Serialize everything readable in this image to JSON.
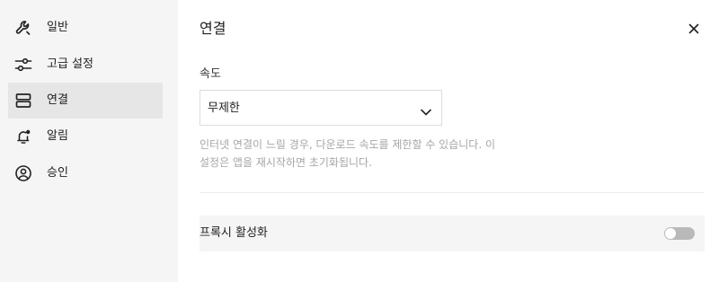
{
  "sidebar": {
    "items": [
      {
        "label": "일반",
        "icon": "wrench-icon",
        "active": false
      },
      {
        "label": "고급 설정",
        "icon": "sliders-icon",
        "active": false
      },
      {
        "label": "연결",
        "icon": "connection-icon",
        "active": true
      },
      {
        "label": "알림",
        "icon": "bell-icon",
        "active": false
      },
      {
        "label": "승인",
        "icon": "user-circle-icon",
        "active": false
      }
    ]
  },
  "header": {
    "title": "연결",
    "close_glyph": "×"
  },
  "speed": {
    "label": "속도",
    "selected": "무제한",
    "help_line1": "인터넷 연결이 느릴 경우, 다운로드 속도를 제한할 수 있습니다. 이",
    "help_line2": "설정은 앱을 재시작하면 초기화됩니다."
  },
  "proxy": {
    "label": "프록시 활성화",
    "enabled": false
  },
  "colors": {
    "sidebar_bg": "#f5f5f5",
    "active_bg": "#e6e6e6",
    "toggle_off": "#b9b9b9"
  }
}
